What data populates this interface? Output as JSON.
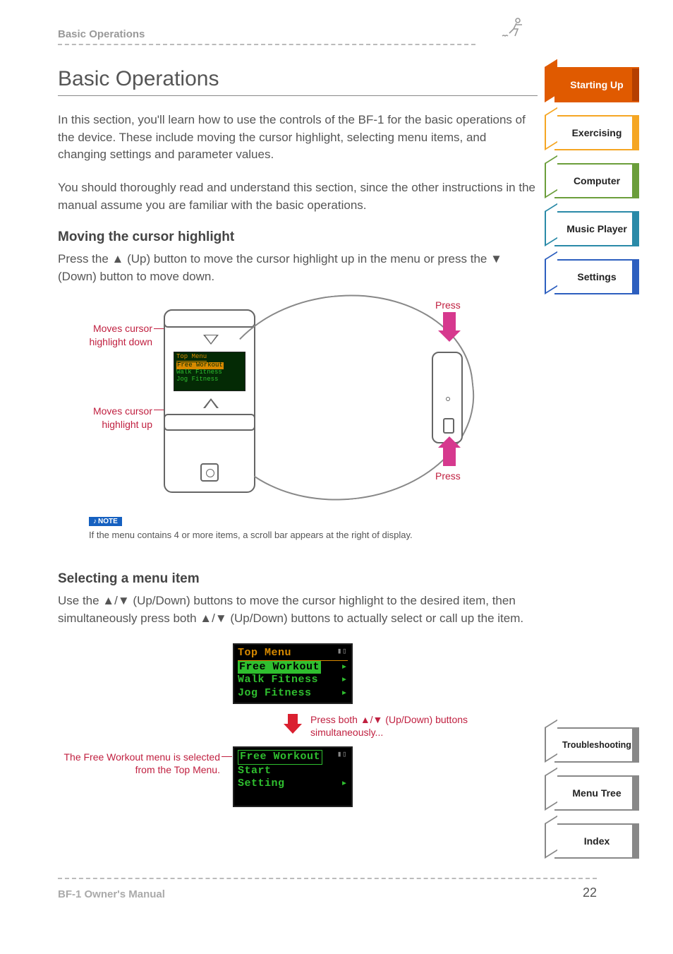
{
  "header": {
    "breadcrumb": "Basic Operations"
  },
  "title": "Basic Operations",
  "intro1": "In this section, you'll learn how to use the controls of the BF-1 for the basic operations of the device. These include moving the cursor highlight, selecting menu items, and changing settings and parameter values.",
  "intro2": "You should thoroughly read and understand this section, since the other instructions in the manual assume you are familiar with the basic operations.",
  "section1": {
    "heading": "Moving the cursor highlight",
    "body": "Press the ▲ (Up) button to move the cursor highlight up in the menu or press the ▼ (Down) button to move down.",
    "label_down": "Moves cursor highlight down",
    "label_up": "Moves cursor highlight up",
    "press": "Press",
    "screen": {
      "title": "Top Menu",
      "items": [
        "Free Workout",
        "Walk Fitness",
        "Jog Fitness"
      ],
      "selected_index": 0
    },
    "note_badge": "NOTE",
    "note_text": "If the menu contains 4 or more items, a scroll bar appears at the right of display."
  },
  "section2": {
    "heading": "Selecting a menu item",
    "body": "Use the ▲/▼ (Up/Down) buttons to move the cursor highlight to the desired item, then simultaneously press both ▲/▼ (Up/Down) buttons to actually select or call up the item.",
    "screen1": {
      "title": "Top Menu",
      "items": [
        "Free Workout",
        "Walk Fitness",
        "Jog Fitness"
      ],
      "selected_index": 0
    },
    "press_both": "Press both ▲/▼ (Up/Down) buttons simultaneously...",
    "screen2": {
      "title": "Free Workout",
      "items": [
        "Start",
        "Setting"
      ]
    },
    "label_fw": "The Free Workout menu is selected from the Top Menu."
  },
  "tabs_top": [
    {
      "label": "Starting Up",
      "cls": "starting"
    },
    {
      "label": "Exercising",
      "cls": "exercising"
    },
    {
      "label": "Computer",
      "cls": "computer"
    },
    {
      "label": "Music Player",
      "cls": "music"
    },
    {
      "label": "Settings",
      "cls": "settings"
    }
  ],
  "tabs_bottom": [
    {
      "label": "Troubleshooting",
      "cls": "trouble"
    },
    {
      "label": "Menu Tree",
      "cls": "menutree"
    },
    {
      "label": "Index",
      "cls": "index"
    }
  ],
  "footer": {
    "manual": "BF-1 Owner's Manual",
    "page": "22"
  }
}
